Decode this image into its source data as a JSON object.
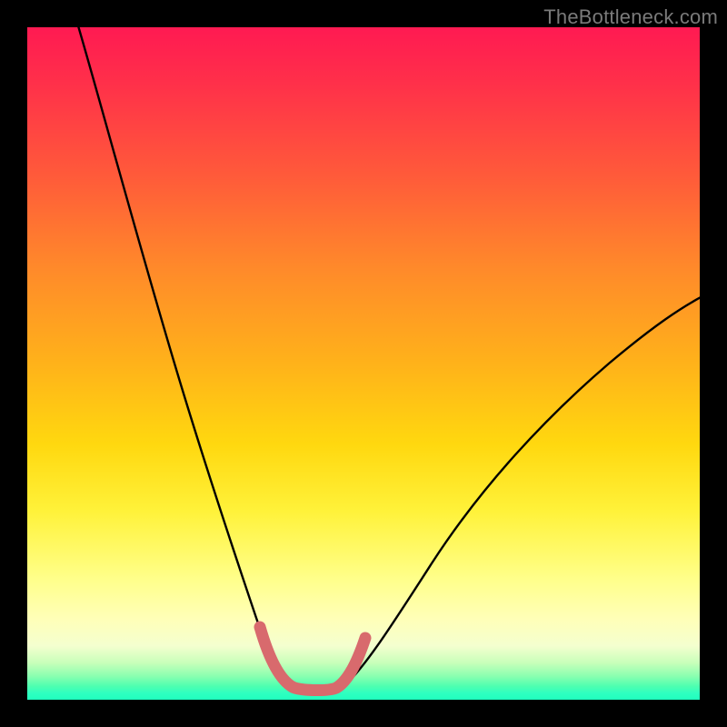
{
  "watermark": "TheBottleneck.com",
  "chart_data": {
    "type": "line",
    "title": "",
    "xlabel": "",
    "ylabel": "",
    "xlim": [
      0,
      100
    ],
    "ylim": [
      0,
      100
    ],
    "note": "Background color encodes a heat gradient from red (top / high bottleneck) to green (bottom / low bottleneck). Curves depict bottleneck percentage vs. some ratio; the valley where curve touches green band is the optimal point.",
    "series": [
      {
        "name": "bottleneck-curve",
        "color": "#000000",
        "x": [
          8,
          10,
          12,
          15,
          18,
          21,
          24,
          27,
          30,
          32,
          34,
          36,
          38,
          40
        ],
        "y": [
          100,
          90,
          80,
          68,
          56,
          44,
          33,
          23,
          14,
          8,
          5,
          3,
          2,
          1
        ]
      },
      {
        "name": "bottleneck-curve-right",
        "color": "#000000",
        "x": [
          44,
          46,
          48,
          51,
          55,
          60,
          66,
          73,
          80,
          88,
          95,
          100
        ],
        "y": [
          1,
          2,
          4,
          7,
          12,
          19,
          27,
          35,
          43,
          50,
          56,
          60
        ]
      },
      {
        "name": "valley-highlight",
        "color": "#e57373",
        "x": [
          32,
          34,
          36,
          38,
          40,
          42,
          44,
          46,
          48
        ],
        "y": [
          8,
          4,
          2,
          1,
          1,
          1,
          2,
          3,
          5
        ]
      }
    ],
    "optimal_x": 41,
    "optimal_y": 1
  }
}
